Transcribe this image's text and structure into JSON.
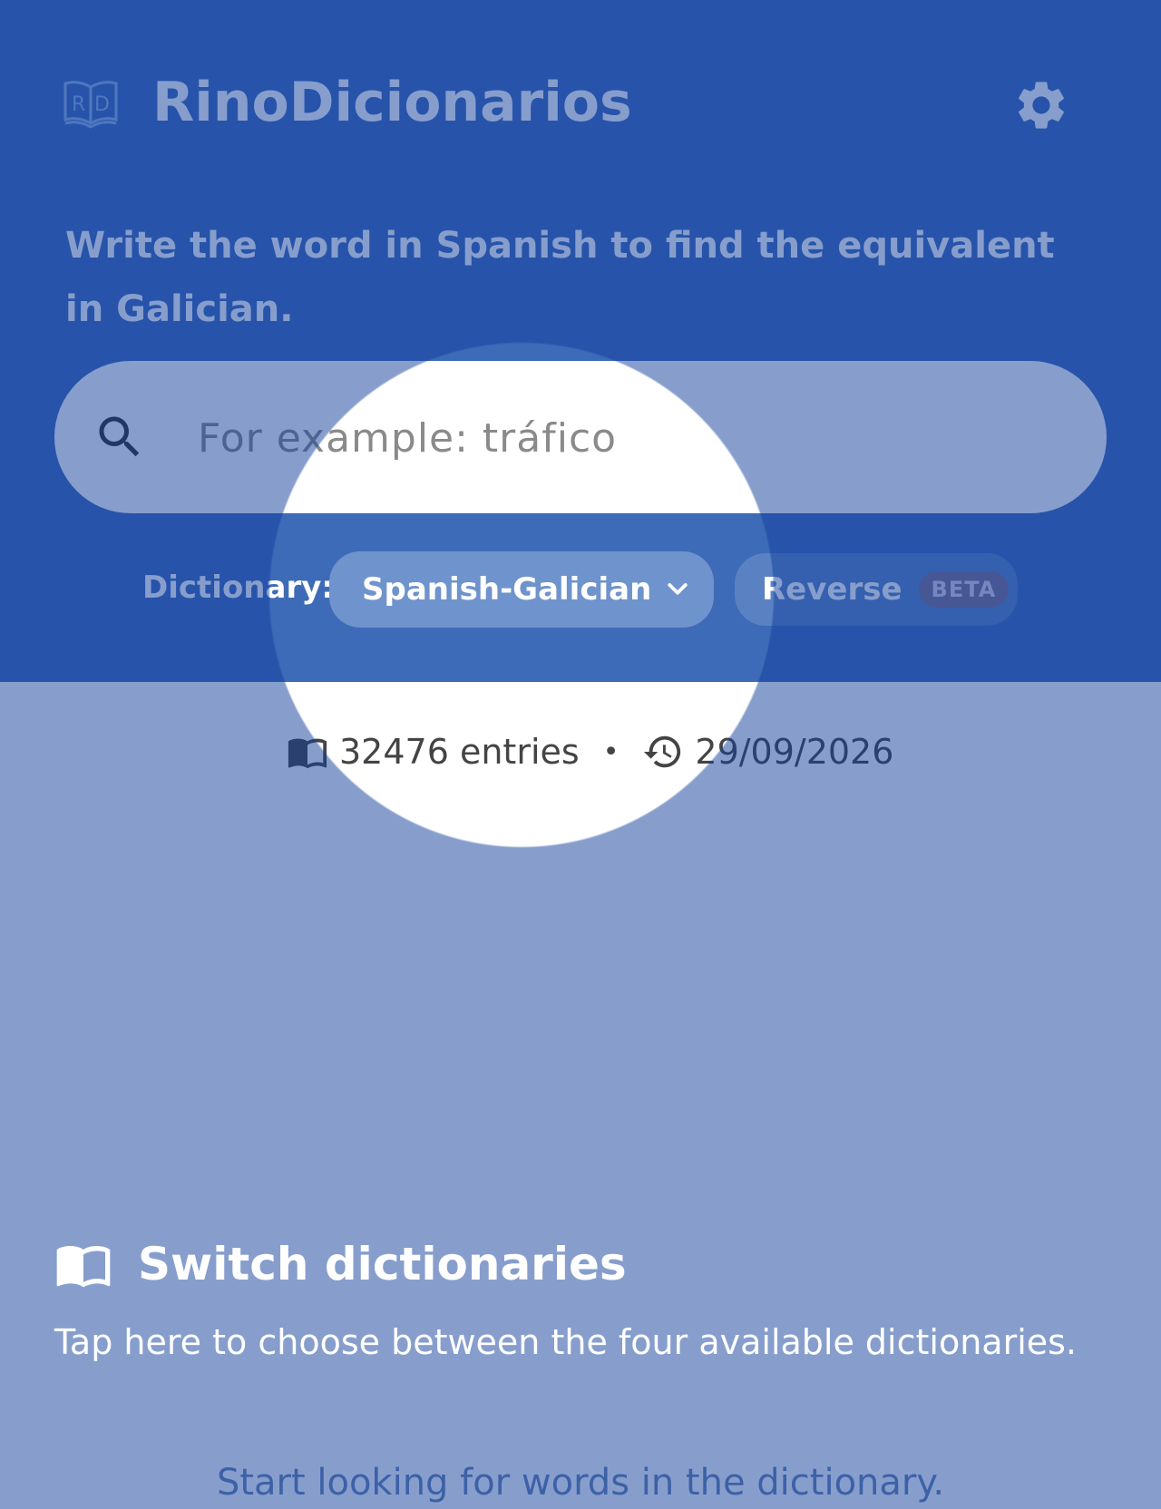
{
  "header": {
    "app_title": "RinoDicionarios",
    "logo_icon": "book-rd-logo-icon",
    "settings_icon": "gear-icon",
    "hint": "Write the word in Spanish to find the equivalent in Galician."
  },
  "search": {
    "icon": "search-icon",
    "placeholder": "For example: tráfico",
    "value": ""
  },
  "dictionary": {
    "label": "Dictionary:",
    "selected": "Spanish-Galician",
    "reverse_label": "Reverse",
    "reverse_badge": "BETA"
  },
  "stats": {
    "entries": "32476 entries",
    "separator": "•",
    "updated": "29/09/2026"
  },
  "coach": {
    "title": "Switch dictionaries",
    "description": "Tap here to choose between the four available dictionaries."
  },
  "empty_state": "Start looking for words in the dictionary.",
  "colors": {
    "brand": "#3e6bb8",
    "overlay": "#103e9b"
  }
}
